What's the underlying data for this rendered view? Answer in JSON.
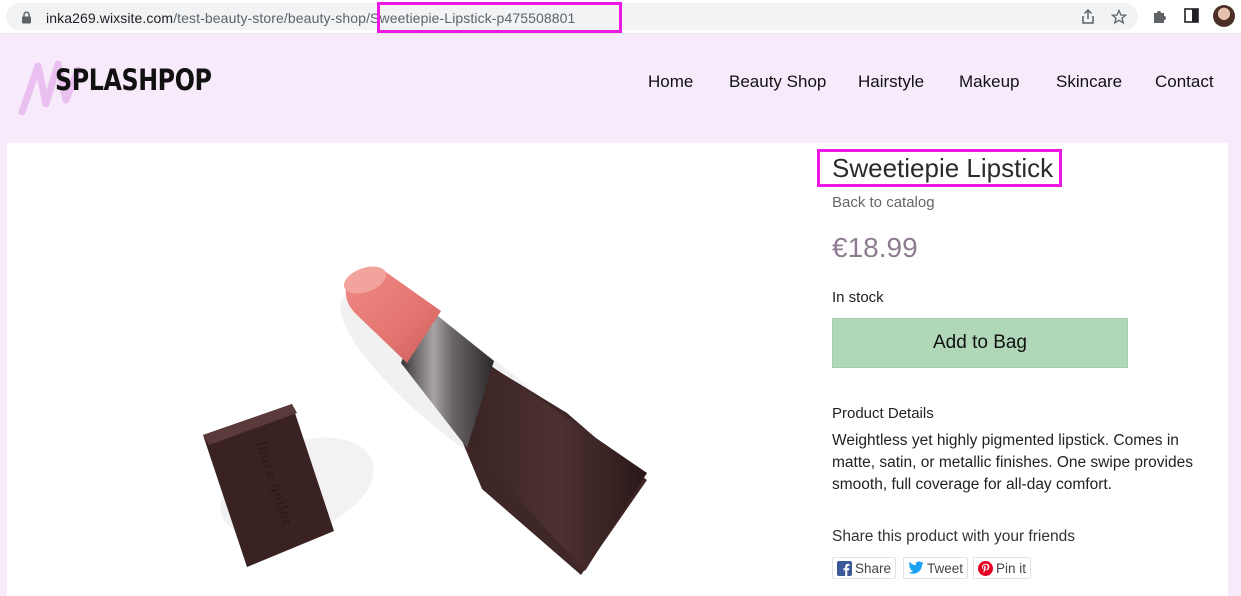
{
  "browser": {
    "url_host": "inka269.wixsite.com",
    "url_path": "/test-beauty-store/beauty-shop/Sweetiepie-Lipstick-p475508801"
  },
  "site": {
    "logo": "SPLASHPOP",
    "nav": [
      "Home",
      "Beauty Shop",
      "Hairstyle",
      "Makeup",
      "Skincare",
      "Contact"
    ]
  },
  "product": {
    "title": "Sweetiepie Lipstick",
    "back_link": "Back to catalog",
    "price": "€18.99",
    "stock": "In stock",
    "add_to_bag": "Add to Bag",
    "details_heading": "Product Details",
    "details": "Weightless yet highly pigmented lipstick. Comes in matte, satin, or metallic finishes. One swipe provides smooth, full coverage for all-day comfort.",
    "image_alt": "Lipstick product photo",
    "cap_engraving": "laura geller"
  },
  "share": {
    "heading": "Share this product with your friends",
    "facebook": "Share",
    "twitter": "Tweet",
    "pinterest": "Pin it"
  },
  "colors": {
    "header_bg": "#f7ebfb",
    "highlight": "#ee18e6",
    "button_bg": "#b1d7b9",
    "price": "#8f7c93"
  }
}
